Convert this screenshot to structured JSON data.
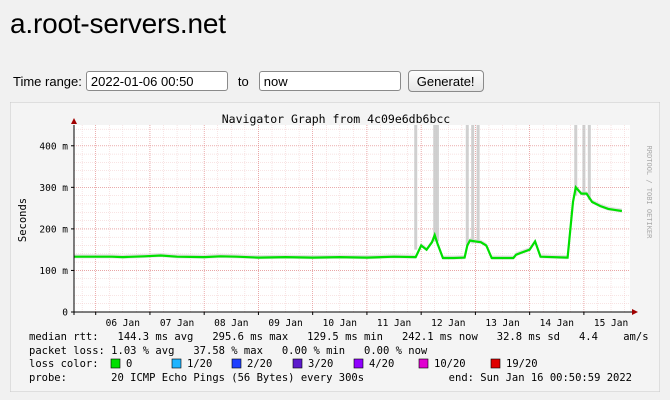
{
  "page": {
    "title": "a.root-servers.net"
  },
  "controls": {
    "time_range_label": "Time range:",
    "from_value": "2022-01-06 00:50",
    "to_label": "to",
    "to_value": "now",
    "generate_label": "Generate!"
  },
  "graph": {
    "side_label": "RRDTOOL / TOBI OETIKER",
    "legend": {
      "median_rtt": "median rtt:   144.3 ms avg   295.6 ms max   129.5 ms min   242.1 ms now   32.8 ms sd   4.4    am/s",
      "packet_loss": "packet loss: 1.03 % avg   37.58 % max   0.00 % min   0.00 % now",
      "loss_color_label": "loss color:",
      "probe": "probe:       20 ICMP Echo Pings (56 Bytes) every 300s",
      "end": "end: Sun Jan 16 00:50:59 2022"
    }
  },
  "chart_data": {
    "type": "line",
    "title": "Navigator Graph from 4c09e6db6bcc",
    "ylabel": "Seconds",
    "xlabel": "",
    "ylim": [
      0,
      450
    ],
    "y_ticks": [
      {
        "value": 0,
        "label": "0"
      },
      {
        "value": 100,
        "label": "100 m"
      },
      {
        "value": 200,
        "label": "200 m"
      },
      {
        "value": 300,
        "label": "300 m"
      },
      {
        "value": 400,
        "label": "400 m"
      }
    ],
    "xlim": [
      5.6,
      15.85
    ],
    "x_ticks": [
      {
        "value": 6,
        "label": "06 Jan"
      },
      {
        "value": 7,
        "label": "07 Jan"
      },
      {
        "value": 8,
        "label": "08 Jan"
      },
      {
        "value": 9,
        "label": "09 Jan"
      },
      {
        "value": 10,
        "label": "10 Jan"
      },
      {
        "value": 11,
        "label": "11 Jan"
      },
      {
        "value": 12,
        "label": "12 Jan"
      },
      {
        "value": 13,
        "label": "13 Jan"
      },
      {
        "value": 14,
        "label": "14 Jan"
      },
      {
        "value": 15,
        "label": "15 Jan"
      }
    ],
    "loss_colors": [
      {
        "label": "0",
        "color": "#00e000"
      },
      {
        "label": "1/20",
        "color": "#1fb4ff"
      },
      {
        "label": "2/20",
        "color": "#2040ff"
      },
      {
        "label": "3/20",
        "color": "#5c1acc"
      },
      {
        "label": "4/20",
        "color": "#9000ff"
      },
      {
        "label": "10/20",
        "color": "#e000d0"
      },
      {
        "label": "19/20",
        "color": "#e00000"
      }
    ],
    "median_series": {
      "name": "median rtt",
      "points": [
        [
          5.6,
          133
        ],
        [
          6.3,
          133
        ],
        [
          6.5,
          132
        ],
        [
          6.9,
          134
        ],
        [
          7.2,
          136
        ],
        [
          7.5,
          133
        ],
        [
          8.0,
          132
        ],
        [
          8.3,
          134
        ],
        [
          8.6,
          133
        ],
        [
          9.0,
          131
        ],
        [
          9.5,
          132
        ],
        [
          10.0,
          131
        ],
        [
          10.5,
          132
        ],
        [
          11.0,
          131
        ],
        [
          11.5,
          133
        ],
        [
          11.9,
          132
        ],
        [
          12.0,
          160
        ],
        [
          12.1,
          150
        ],
        [
          12.2,
          168
        ],
        [
          12.25,
          185
        ],
        [
          12.3,
          165
        ],
        [
          12.4,
          130
        ],
        [
          12.6,
          130
        ],
        [
          12.8,
          131
        ],
        [
          12.85,
          160
        ],
        [
          12.9,
          172
        ],
        [
          13.0,
          170
        ],
        [
          13.1,
          168
        ],
        [
          13.2,
          160
        ],
        [
          13.3,
          130
        ],
        [
          13.7,
          130
        ],
        [
          13.75,
          138
        ],
        [
          13.85,
          143
        ],
        [
          14.0,
          150
        ],
        [
          14.1,
          170
        ],
        [
          14.2,
          133
        ],
        [
          14.7,
          131
        ],
        [
          14.8,
          265
        ],
        [
          14.85,
          300
        ],
        [
          14.95,
          285
        ],
        [
          15.05,
          285
        ],
        [
          15.15,
          265
        ],
        [
          15.3,
          255
        ],
        [
          15.45,
          248
        ],
        [
          15.6,
          245
        ],
        [
          15.7,
          243
        ]
      ]
    },
    "smoke_spikes": [
      {
        "x": 11.9,
        "low": 150,
        "high": 460
      },
      {
        "x": 12.25,
        "low": 170,
        "high": 460
      },
      {
        "x": 12.3,
        "low": 170,
        "high": 460
      },
      {
        "x": 12.85,
        "low": 160,
        "high": 460
      },
      {
        "x": 12.95,
        "low": 165,
        "high": 460
      },
      {
        "x": 13.05,
        "low": 165,
        "high": 460
      },
      {
        "x": 14.85,
        "low": 280,
        "high": 460
      },
      {
        "x": 15.0,
        "low": 280,
        "high": 460
      },
      {
        "x": 15.1,
        "low": 270,
        "high": 460
      }
    ]
  }
}
